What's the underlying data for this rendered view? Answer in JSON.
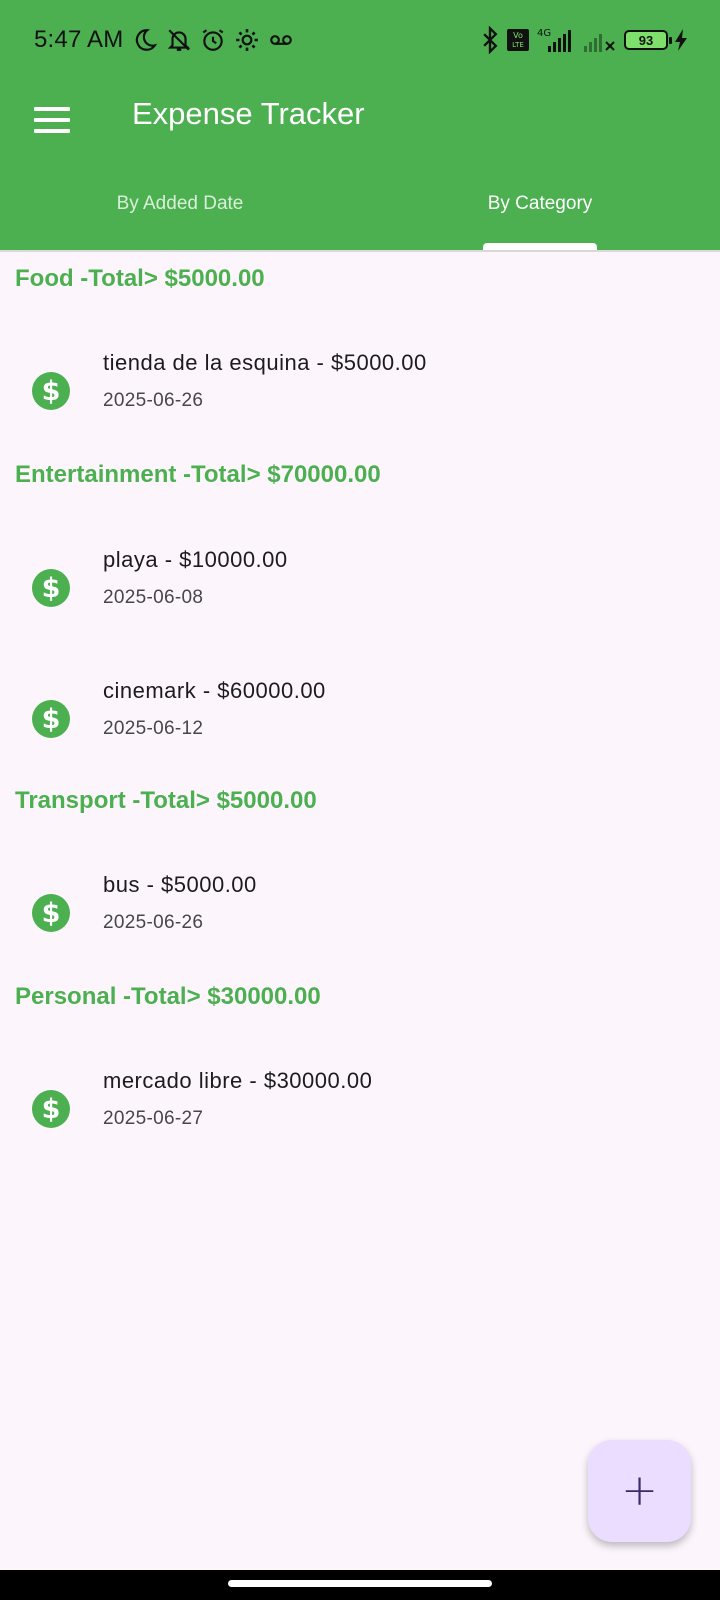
{
  "status_bar": {
    "time": "5:47 AM",
    "battery": "93",
    "network": "4G",
    "volte": "Vo LTE"
  },
  "app_bar": {
    "title": "Expense Tracker"
  },
  "tabs": [
    {
      "label": "By Added Date",
      "active": false
    },
    {
      "label": "By Category",
      "active": true
    }
  ],
  "categories": [
    {
      "header": "Food -Total> $5000.00",
      "items": [
        {
          "title": "tienda de la esquina - $5000.00",
          "date": "2025-06-26"
        }
      ]
    },
    {
      "header": "Entertainment -Total> $70000.00",
      "items": [
        {
          "title": "playa - $10000.00",
          "date": "2025-06-08"
        },
        {
          "title": "cinemark - $60000.00",
          "date": "2025-06-12"
        }
      ]
    },
    {
      "header": "Transport -Total> $5000.00",
      "items": [
        {
          "title": "bus - $5000.00",
          "date": "2025-06-26"
        }
      ]
    },
    {
      "header": "Personal -Total> $30000.00",
      "items": [
        {
          "title": "mercado libre - $30000.00",
          "date": "2025-06-27"
        }
      ]
    }
  ],
  "item_icon_glyph": "$",
  "fab": {
    "label": "+"
  },
  "colors": {
    "primary": "#4CAF50",
    "background": "#FCF6FC",
    "fab": "#EADDFF"
  }
}
